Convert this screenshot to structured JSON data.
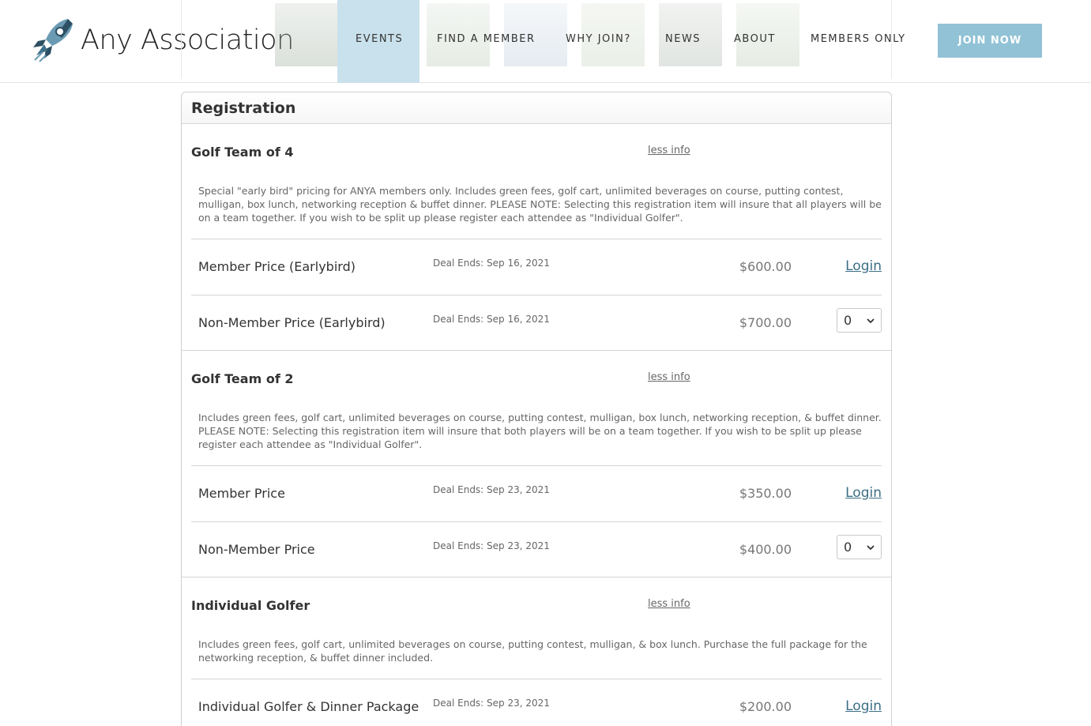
{
  "header": {
    "logo_text": "Any Association",
    "nav": [
      "EVENTS",
      "FIND A MEMBER",
      "WHY JOIN?",
      "NEWS",
      "ABOUT",
      "MEMBERS ONLY"
    ],
    "active_nav": "EVENTS",
    "join_label": "JOIN NOW",
    "accent_color": "#92c2d6"
  },
  "registration": {
    "title": "Registration",
    "sections": [
      {
        "title": "Golf Team of 4",
        "less_info": "less info",
        "description": "Special \"early bird\" pricing for ANYA members only. Includes green fees, golf cart, unlimited beverages on course, putting contest, mulligan, box lunch, networking reception & buffet dinner. PLEASE NOTE: Selecting this registration item will insure that all players will be on a team together. If you wish to be split up please register each attendee as \"Individual Golfer\".",
        "items": [
          {
            "name": "Member Price (Earlybird)",
            "deal": "Deal Ends: Sep 16, 2021",
            "price": "$600.00",
            "action": "Login"
          },
          {
            "name": "Non-Member Price (Earlybird)",
            "deal": "Deal Ends: Sep 16, 2021",
            "price": "$700.00",
            "qty": "0"
          }
        ]
      },
      {
        "title": "Golf Team of 2",
        "less_info": "less info",
        "description": "Includes green fees, golf cart, unlimited beverages on course, putting contest, mulligan, box lunch, networking reception, & buffet dinner. PLEASE NOTE: Selecting this registration item will insure that both players will be on a team together. If you wish to be split up please register each attendee as \"Individual Golfer\".",
        "items": [
          {
            "name": "Member Price",
            "deal": "Deal Ends: Sep 23, 2021",
            "price": "$350.00",
            "action": "Login"
          },
          {
            "name": "Non-Member Price",
            "deal": "Deal Ends: Sep 23, 2021",
            "price": "$400.00",
            "qty": "0"
          }
        ]
      },
      {
        "title": "Individual Golfer",
        "less_info": "less info",
        "description": "Includes green fees, golf cart, unlimited beverages on course, putting contest, mulligan, & box lunch. Purchase the full package for the networking reception, & buffet dinner included.",
        "items": [
          {
            "name": "Individual Golfer & Dinner Package",
            "deal": "Deal Ends: Sep 23, 2021",
            "price": "$200.00",
            "action": "Login"
          }
        ]
      }
    ]
  }
}
